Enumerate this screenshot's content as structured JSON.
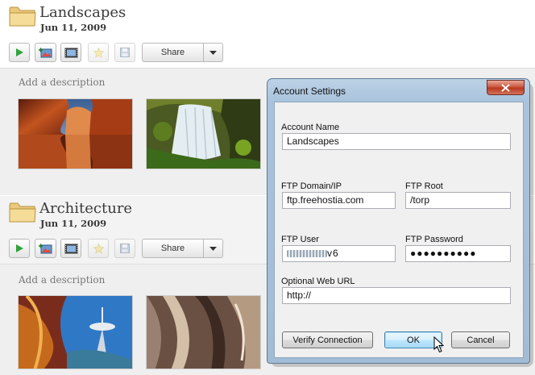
{
  "albums": [
    {
      "title": "Landscapes",
      "date": "Jun 11, 2009",
      "share_label": "Share",
      "description_placeholder": "Add a description"
    },
    {
      "title": "Architecture",
      "date": "Jun 11, 2009",
      "share_label": "Share",
      "description_placeholder": "Add a description"
    }
  ],
  "dialog": {
    "title": "Account Settings",
    "account_name_label": "Account Name",
    "account_name_value": "Landscapes",
    "ftp_domain_label": "FTP Domain/IP",
    "ftp_domain_value": "ftp.freehostia.com",
    "ftp_root_label": "FTP Root",
    "ftp_root_value": "/torp",
    "ftp_user_label": "FTP User",
    "ftp_user_suffix": "v6",
    "ftp_password_label": "FTP Password",
    "ftp_password_value": "●●●●●●●●●●",
    "web_url_label": "Optional Web URL",
    "web_url_value": "http://",
    "verify_label": "Verify Connection",
    "ok_label": "OK",
    "cancel_label": "Cancel"
  },
  "colors": {
    "accent_blue": "#3c7fb1",
    "close_red": "#c9503a",
    "play_green": "#2fa33a"
  },
  "icons": {
    "folder": "folder-icon",
    "play": "play-icon",
    "add_photo": "add-photo-icon",
    "slideshow": "film-icon",
    "star": "star-icon",
    "save": "floppy-icon",
    "share_menu": "chevron-down-icon",
    "close": "close-icon"
  }
}
